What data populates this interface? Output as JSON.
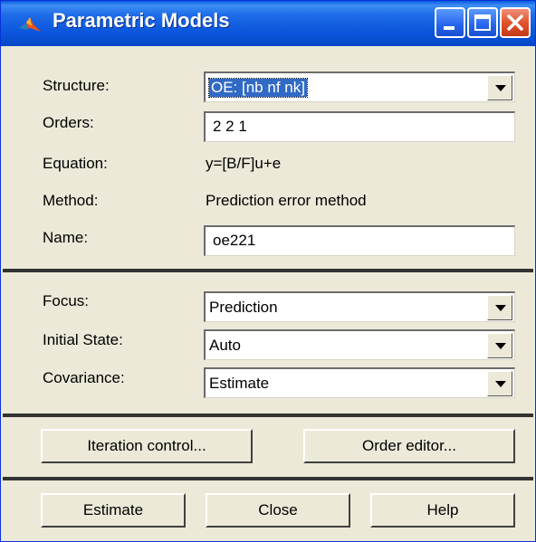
{
  "window": {
    "title": "Parametric Models",
    "buttons": {
      "minimize": "minimize-icon",
      "maximize": "maximize-icon",
      "close": "close-icon"
    }
  },
  "model": {
    "structure_label": "Structure:",
    "structure_value": "OE: [nb nf nk]",
    "orders_label": "Orders:",
    "orders_value": "2 2 1",
    "equation_label": "Equation:",
    "equation_value": "y=[B/F]u+e",
    "method_label": "Method:",
    "method_value": "Prediction error method",
    "name_label": "Name:",
    "name_value": "oe221"
  },
  "options": {
    "focus_label": "Focus:",
    "focus_value": "Prediction",
    "initial_state_label": "Initial State:",
    "initial_state_value": "Auto",
    "covariance_label": "Covariance:",
    "covariance_value": "Estimate"
  },
  "tools": {
    "iteration_control": "Iteration control...",
    "order_editor": "Order editor..."
  },
  "actions": {
    "estimate": "Estimate",
    "close": "Close",
    "help": "Help"
  },
  "colors": {
    "titlebar": "#0a55dc",
    "dialog_bg": "#ece9d8",
    "selection": "#316ac5",
    "close_button": "#e2532d"
  }
}
